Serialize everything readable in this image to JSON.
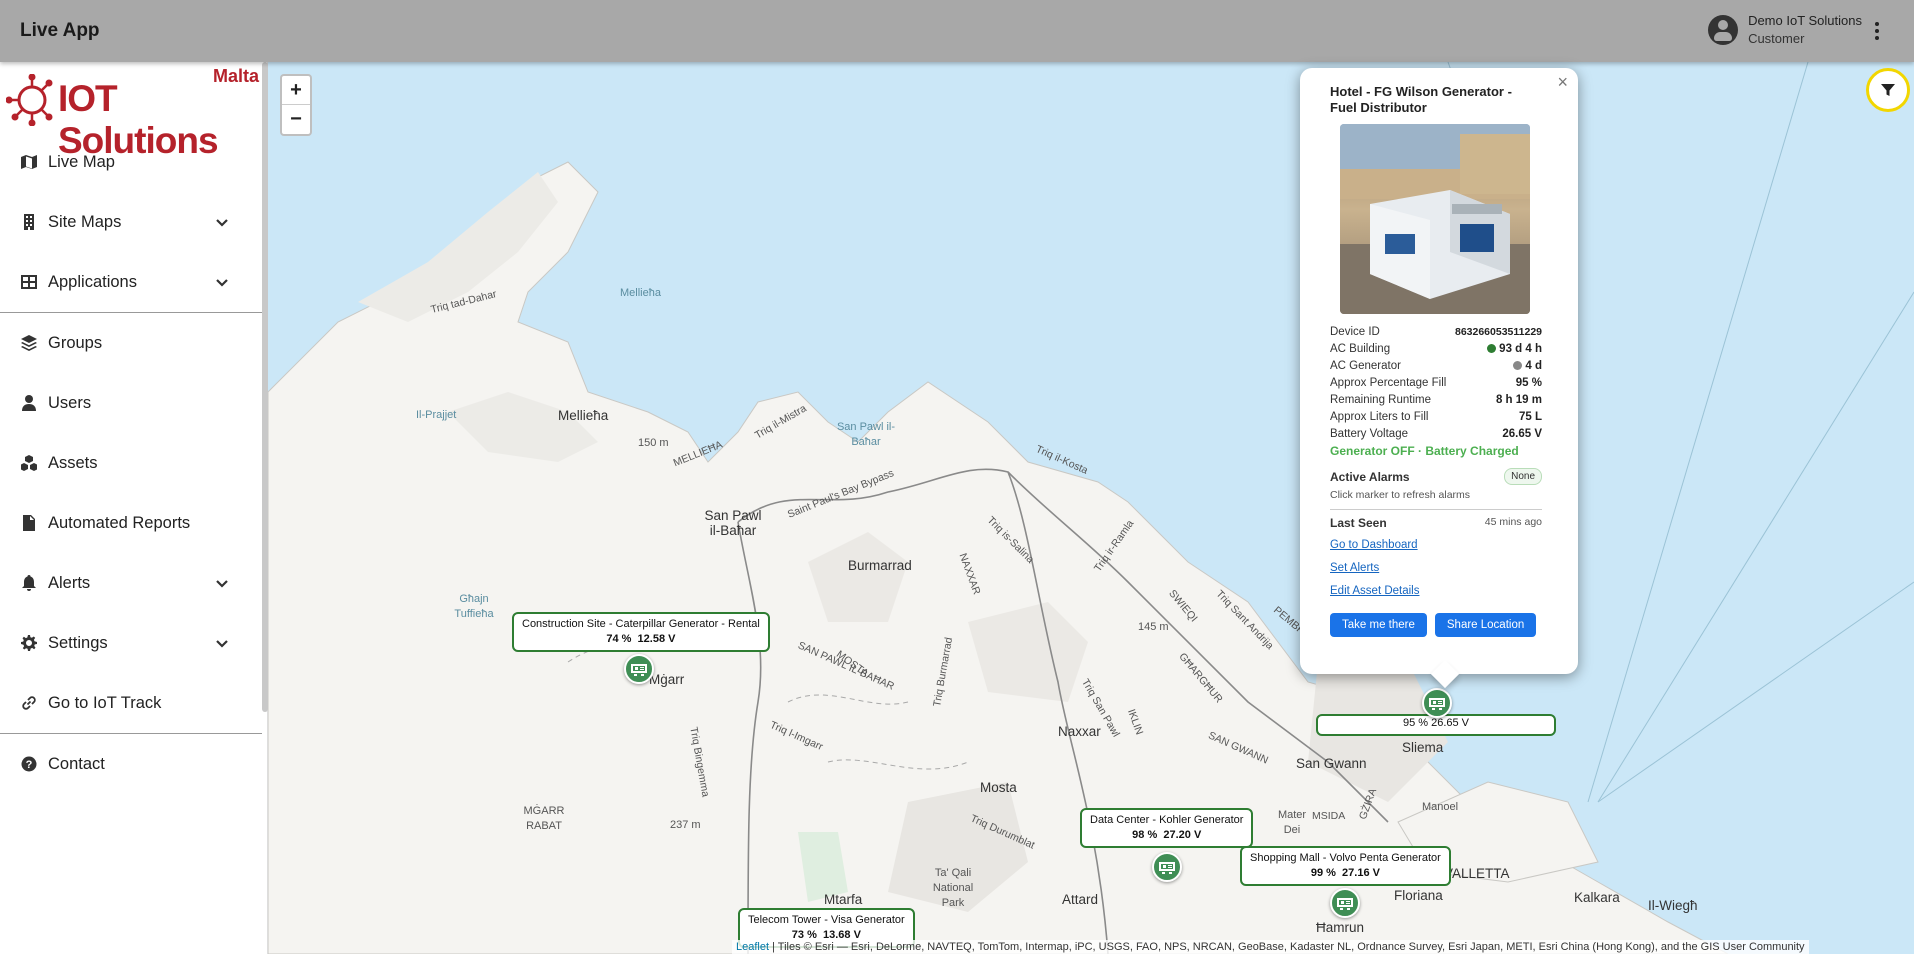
{
  "appbar": {
    "title": "Live App",
    "user_name": "Demo IoT Solutions",
    "user_role": "Customer"
  },
  "logo": {
    "brand": "IOT Solutions",
    "region": "Malta"
  },
  "sidebar": {
    "items": [
      {
        "label": "Live Map",
        "icon": "map-icon"
      },
      {
        "label": "Site Maps",
        "icon": "building-icon",
        "expandable": true
      },
      {
        "label": "Applications",
        "icon": "grid-icon",
        "expandable": true
      },
      {
        "label": "Groups",
        "icon": "layers-icon"
      },
      {
        "label": "Users",
        "icon": "user-icon"
      },
      {
        "label": "Assets",
        "icon": "cubes-icon"
      },
      {
        "label": "Automated Reports",
        "icon": "file-icon"
      },
      {
        "label": "Alerts",
        "icon": "bell-icon",
        "expandable": true
      },
      {
        "label": "Settings",
        "icon": "gear-icon",
        "expandable": true
      },
      {
        "label": "Go to IoT Track",
        "icon": "link-icon"
      },
      {
        "label": "Contact",
        "icon": "help-icon"
      }
    ]
  },
  "map": {
    "zoom_in": "+",
    "zoom_out": "−",
    "places": {
      "mellieha_bay": "Mellieħa",
      "mellieha": "Mellieħa",
      "il_prajjet": "Il-Prajjet",
      "san_pawl_bahar_water": "San Pawl il-Baħar",
      "san_pawl": "San Pawl il-Baħar",
      "burmarrad": "Burmarrad",
      "ghajn_tuffieha": "Għajn Tuffieħa",
      "mgarr": "Mġarr",
      "naxxar": "Naxxar",
      "mosta": "Mosta",
      "san_gwann": "San Gwann",
      "sliema": "Sliema",
      "manoel": "Manoel",
      "valletta": "VALLETTA",
      "floriana": "Floriana",
      "hamrun": "Ħamrun",
      "attard": "Attard",
      "mtarfa": "Mtarfa",
      "kalkara": "Kalkara",
      "il_wiegh": "Il-Wiegħ",
      "mgarr_rabat": "MĠARR RABAT",
      "ta_qali": "Ta' Qali National Park",
      "mater_dei": "Mater Dei",
      "elev_150": "150 m",
      "elev_145": "145 m",
      "elev_237": "237 m"
    },
    "roads": {
      "triq_tad_dahar": "Triq tad-Dahar",
      "mellieha_road": "MELLIEĦA",
      "triq_il_mistra": "Triq il-Mistra",
      "saint_pauls_bypass": "Saint Paul's Bay Bypass",
      "triq_il_kosta": "Triq il-Kosta",
      "triq_is_salina": "Triq is-Salina",
      "triq_ir_ramla": "Triq ir-Ramla",
      "naxxar_road": "NAXXAR",
      "mosta_road": "MOSTA",
      "san_pawl_il_bahar_road": "SAN PAWL IL-BAĦAR",
      "triq_burmarrad": "Triq Burmarrad",
      "triq_l_imgarr": "Triq l-Imgarr",
      "triq_sant_andrija": "Triq Sant Andrija",
      "pembroke": "PEMBROKE",
      "swieqi": "SWIEQI",
      "gharghur": "GĦARGĦUR",
      "triq_san_pawl": "Triq San Pawl",
      "san_gwann_road": "SAN GWANN",
      "triq_durumblat": "Triq Durumblat",
      "iklin": "IKLIN",
      "msida": "MSIDA",
      "gzira": "GŻIRA",
      "triq_bingemma": "Triq Bingemma"
    },
    "markers": [
      {
        "name": "Construction Site - Caterpillar Generator - Rental",
        "fill": "74 %",
        "voltage": "12.58 V"
      },
      {
        "name": "Data Center - Kohler Generator",
        "fill": "98 %",
        "voltage": "27.20 V"
      },
      {
        "name": "Shopping Mall - Volvo Penta Generator",
        "fill": "99 %",
        "voltage": "27.16 V"
      },
      {
        "name": "Telecom Tower - Visa Generator",
        "fill": "73 %",
        "voltage": "13.68 V"
      }
    ],
    "hidden_marker_label": "95 % 26.65 V",
    "attribution_leaflet": "Leaflet",
    "attribution_rest": " | Tiles © Esri — Esri, DeLorme, NAVTEQ, TomTom, Intermap, iPC, USGS, FAO, NPS, NRCAN, GeoBase, Kadaster NL, Ordnance Survey, Esri Japan, METI, Esri China (Hong Kong), and the GIS User Community"
  },
  "popup": {
    "close": "×",
    "title": "Hotel - FG Wilson Generator - Fuel Distributor",
    "rows": [
      {
        "k": "Device ID",
        "v": "863266053511229"
      },
      {
        "k": "AC Building",
        "v": "93 d 4 h",
        "dot": "#2e7d32"
      },
      {
        "k": "AC Generator",
        "v": "4 d",
        "dot": "#888888"
      },
      {
        "k": "Approx Percentage Fill",
        "v": "95 %"
      },
      {
        "k": "Remaining Runtime",
        "v": "8 h 19 m"
      },
      {
        "k": "Approx Liters to Fill",
        "v": "75 L"
      },
      {
        "k": "Battery Voltage",
        "v": "26.65 V"
      }
    ],
    "status": "Generator OFF · Battery Charged",
    "alarms_label": "Active Alarms",
    "alarms_value": "None",
    "alarms_hint": "Click marker to refresh alarms",
    "last_seen_label": "Last Seen",
    "last_seen_value": "45 mins ago",
    "links": [
      "Go to Dashboard",
      "Set Alerts",
      "Edit Asset Details"
    ],
    "btn_take_me": "Take me there",
    "btn_share": "Share Location"
  },
  "colors": {
    "accent": "#1a73e8",
    "brand": "#b5222b",
    "marker": "#3f8e55",
    "status_ok": "#4caf50"
  }
}
